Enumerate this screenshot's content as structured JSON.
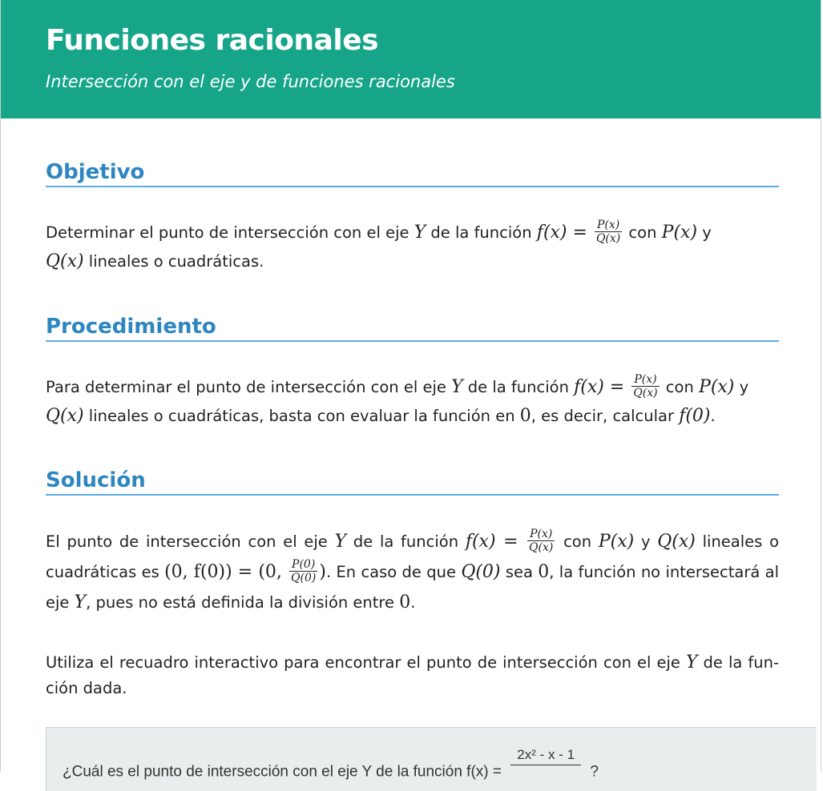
{
  "header": {
    "title": "Funciones racionales",
    "subtitle": "Intersección con el eje y de funciones racionales"
  },
  "sections": {
    "objetivo": {
      "title": "Objetivo",
      "t1": "Determinar el punto de intersección con el eje ",
      "t2": " de la función ",
      "t3": " con ",
      "t4": " y ",
      "t5": " lineales o cuadráticas."
    },
    "procedimiento": {
      "title": "Procedimiento",
      "t1": "Para determinar el punto de intersección con el eje ",
      "t2": " de la función ",
      "t3": " con ",
      "t4": " y ",
      "t5": " lineales o cuadráticas, basta con evaluar la función en ",
      "t6": ", es decir, calcular ",
      "t7": "."
    },
    "solucion": {
      "title": "Solución",
      "t1": "El punto de intersección con el eje ",
      "t2": " de la función ",
      "t3": " con ",
      "t4": " y ",
      "t5": " lineales o cuadráticas es ",
      "t6": ". En caso de que ",
      "t7": " sea ",
      "t8": ", la función no intersectará al eje ",
      "t9": ", pues no está definida la división entre ",
      "t10": "."
    },
    "instruccion": {
      "text": "Utiliza el recuadro interactivo para encontrar el punto de intersección con el eje ",
      "text2": " de la fun­ción dada."
    }
  },
  "math": {
    "Y": "Y",
    "fx": "f(x) = ",
    "Px": "P(x)",
    "Qx": "Q(x)",
    "zero": "0",
    "f0": "f(0)",
    "point_lhs": "(0, f(0)) = (0, ",
    "P0": "P(0)",
    "Q0": "Q(0)",
    "point_rhs": ")"
  },
  "interactive": {
    "question_prefix": "¿Cuál es el punto de intersección con el eje Y de la función  f(x) = ",
    "numerator": "2x² - x - 1",
    "question_suffix": " ?"
  },
  "colors": {
    "header_bg": "#17a589",
    "section_title": "#2e86c1",
    "section_rule": "#5dade2",
    "interactive_bg": "#e8eeed"
  }
}
